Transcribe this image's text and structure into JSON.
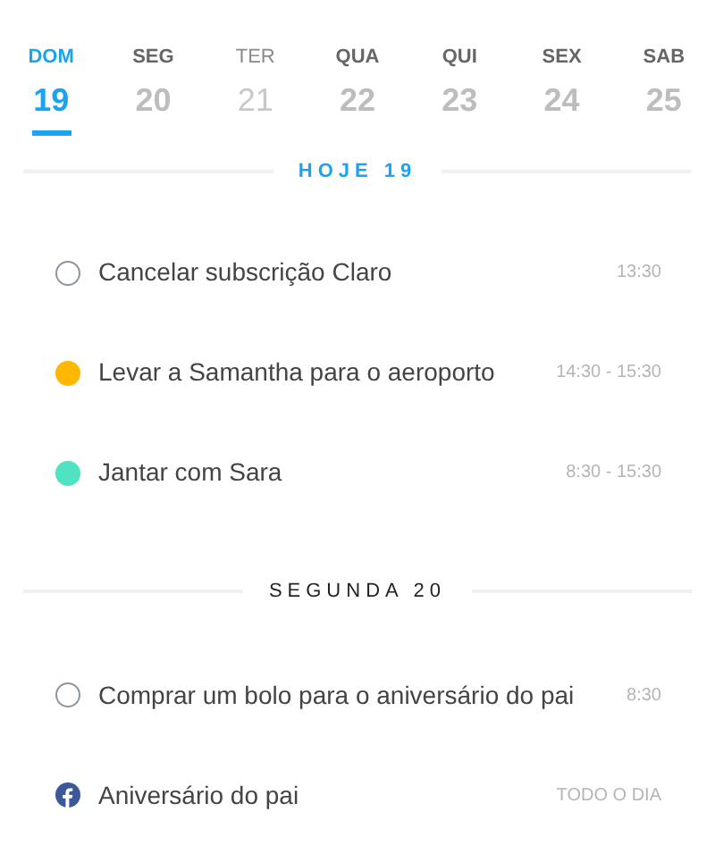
{
  "week": [
    {
      "weekday": "DOM",
      "day": "19",
      "selected": true,
      "dimmed": false
    },
    {
      "weekday": "SEG",
      "day": "20",
      "selected": false,
      "dimmed": false
    },
    {
      "weekday": "TER",
      "day": "21",
      "selected": false,
      "dimmed": true
    },
    {
      "weekday": "QUA",
      "day": "22",
      "selected": false,
      "dimmed": false
    },
    {
      "weekday": "QUI",
      "day": "23",
      "selected": false,
      "dimmed": false
    },
    {
      "weekday": "SEX",
      "day": "24",
      "selected": false,
      "dimmed": false
    },
    {
      "weekday": "SAB",
      "day": "25",
      "selected": false,
      "dimmed": false
    }
  ],
  "sections": [
    {
      "title": "HOJE 19",
      "today": true,
      "items": [
        {
          "kind": "task",
          "title": "Cancelar subscrição Claro",
          "time": "13:30"
        },
        {
          "kind": "event",
          "color": "#ffb800",
          "title": "Levar a Samantha para o aeroporto",
          "time": "14:30 - 15:30"
        },
        {
          "kind": "event",
          "color": "#50e3c2",
          "title": "Jantar com Sara",
          "time": "8:30 - 15:30"
        }
      ]
    },
    {
      "title": "SEGUNDA 20",
      "today": false,
      "items": [
        {
          "kind": "task",
          "title": "Comprar um bolo para o aniversário do pai",
          "time": "8:30"
        },
        {
          "kind": "facebook",
          "title": "Aniversário do pai",
          "time": "TODO O DIA"
        }
      ]
    }
  ]
}
